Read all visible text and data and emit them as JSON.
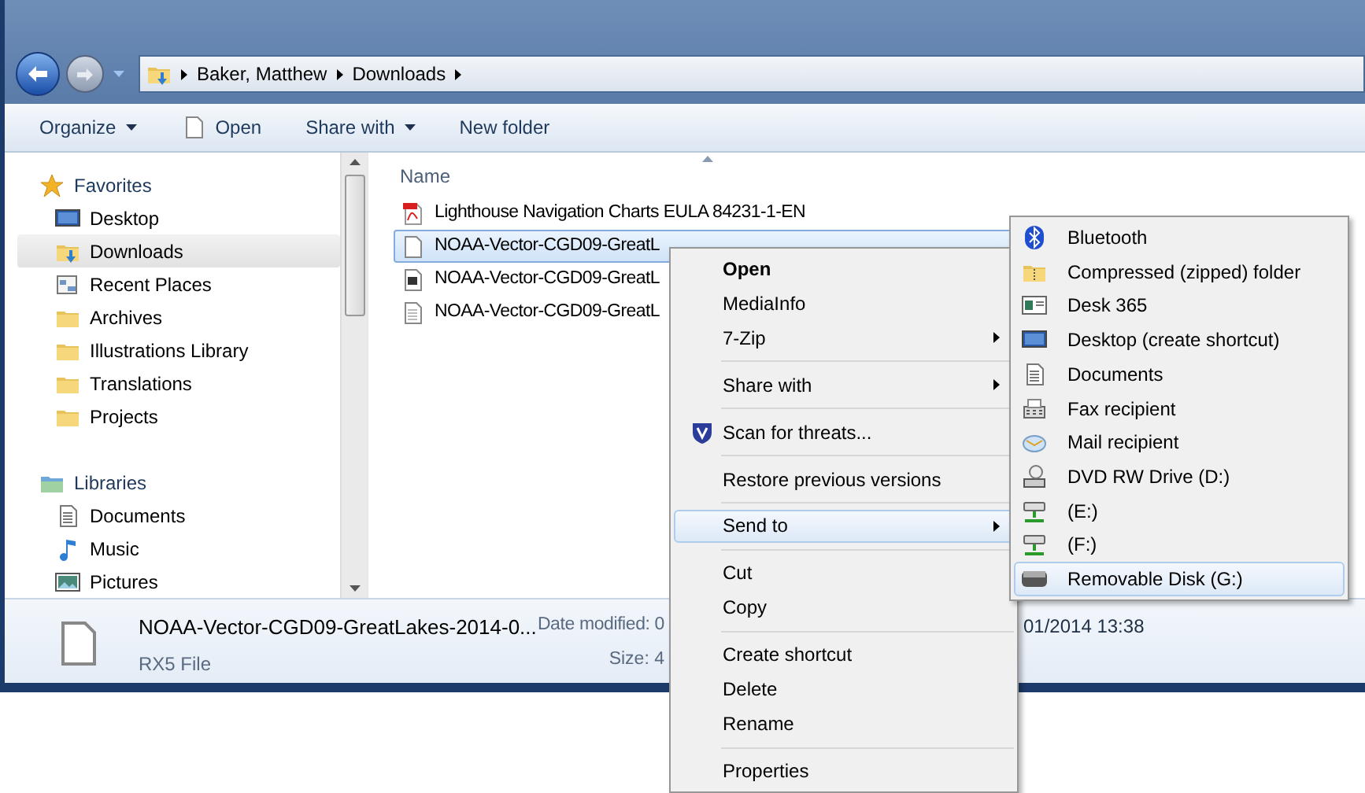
{
  "address_bar": {
    "breadcrumb": [
      "Baker, Matthew",
      "Downloads"
    ]
  },
  "toolbar": {
    "items": [
      {
        "label": "Organize",
        "kind": "dropdown"
      },
      {
        "label": "Open",
        "kind": "icon"
      },
      {
        "label": "Share with",
        "kind": "dropdown"
      },
      {
        "label": "New folder",
        "kind": "plain"
      }
    ]
  },
  "sidebar": {
    "groups": [
      {
        "label": "Favorites",
        "children": [
          {
            "label": "Desktop",
            "selected": false
          },
          {
            "label": "Downloads",
            "selected": true
          },
          {
            "label": "Recent Places",
            "selected": false
          },
          {
            "label": "Archives",
            "selected": false
          },
          {
            "label": "Illustrations Library",
            "selected": false
          },
          {
            "label": "Translations",
            "selected": false
          },
          {
            "label": "Projects",
            "selected": false
          }
        ]
      },
      {
        "label": "Libraries",
        "children": [
          {
            "label": "Documents",
            "selected": false
          },
          {
            "label": "Music",
            "selected": false
          },
          {
            "label": "Pictures",
            "selected": false
          }
        ]
      }
    ]
  },
  "file_list": {
    "columns": [
      "Name"
    ],
    "rows": [
      {
        "name": "Lighthouse Navigation Charts EULA 84231-1-EN",
        "selected": false
      },
      {
        "name": "NOAA-Vector-CGD09-GreatL",
        "selected": true
      },
      {
        "name": "NOAA-Vector-CGD09-GreatL",
        "selected": false
      },
      {
        "name": "NOAA-Vector-CGD09-GreatL",
        "selected": false
      }
    ]
  },
  "details": {
    "name": "NOAA-Vector-CGD09-GreatLakes-2014-0...",
    "type": "RX5 File",
    "date_label": "Date modified: 0",
    "date_value": "01/2014 13:38",
    "size_label": "Size: 4"
  },
  "context_menu": {
    "items": [
      {
        "kind": "item",
        "label": "Open",
        "default": true,
        "submenu": false,
        "selected": false
      },
      {
        "kind": "item",
        "label": "MediaInfo",
        "default": false,
        "submenu": false,
        "selected": false
      },
      {
        "kind": "item",
        "label": "7-Zip",
        "default": false,
        "submenu": true,
        "selected": false
      },
      {
        "kind": "separator"
      },
      {
        "kind": "item",
        "label": "Share with",
        "default": false,
        "submenu": true,
        "selected": false
      },
      {
        "kind": "separator"
      },
      {
        "kind": "item",
        "label": "Scan for threats...",
        "default": false,
        "submenu": false,
        "selected": false
      },
      {
        "kind": "separator"
      },
      {
        "kind": "item",
        "label": "Restore previous versions",
        "default": false,
        "submenu": false,
        "selected": false
      },
      {
        "kind": "separator"
      },
      {
        "kind": "item",
        "label": "Send to",
        "default": false,
        "submenu": true,
        "selected": true
      },
      {
        "kind": "separator"
      },
      {
        "kind": "item",
        "label": "Cut",
        "default": false,
        "submenu": false,
        "selected": false
      },
      {
        "kind": "item",
        "label": "Copy",
        "default": false,
        "submenu": false,
        "selected": false
      },
      {
        "kind": "separator"
      },
      {
        "kind": "item",
        "label": "Create shortcut",
        "default": false,
        "submenu": false,
        "selected": false
      },
      {
        "kind": "item",
        "label": "Delete",
        "default": false,
        "submenu": false,
        "selected": false
      },
      {
        "kind": "item",
        "label": "Rename",
        "default": false,
        "submenu": false,
        "selected": false
      },
      {
        "kind": "separator"
      },
      {
        "kind": "item",
        "label": "Properties",
        "default": false,
        "submenu": false,
        "selected": false
      }
    ]
  },
  "send_to_menu": {
    "items": [
      {
        "label": "Bluetooth",
        "selected": false
      },
      {
        "label": "Compressed (zipped) folder",
        "selected": false
      },
      {
        "label": "Desk 365",
        "selected": false
      },
      {
        "label": "Desktop (create shortcut)",
        "selected": false
      },
      {
        "label": "Documents",
        "selected": false
      },
      {
        "label": "Fax recipient",
        "selected": false
      },
      {
        "label": "Mail recipient",
        "selected": false
      },
      {
        "label": "DVD RW Drive (D:)",
        "selected": false
      },
      {
        "label": "(E:)",
        "selected": false
      },
      {
        "label": "(F:)",
        "selected": false
      },
      {
        "label": "Removable Disk (G:)",
        "selected": true
      }
    ]
  }
}
